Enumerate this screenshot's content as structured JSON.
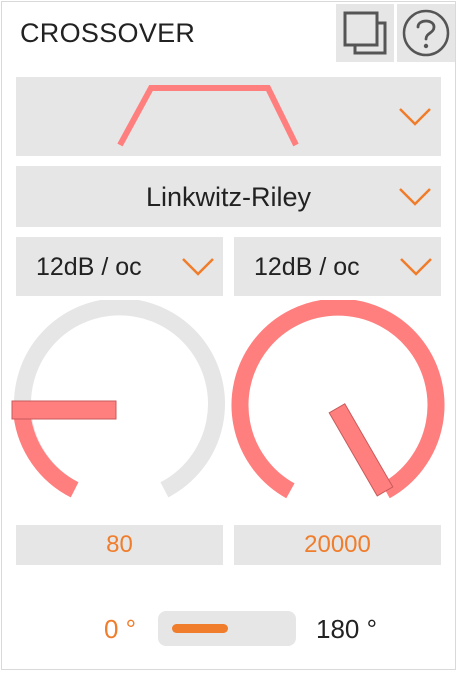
{
  "header": {
    "title": "CROSSOVER"
  },
  "icons": {
    "popout": "popout-icon",
    "help": "help-icon",
    "chevron": "chevron-down-icon"
  },
  "filter_shape": {
    "type": "band-pass"
  },
  "filter_type": {
    "selected": "Linkwitz-Riley"
  },
  "slopes": {
    "low": "12dB / oc",
    "high": "12dB / oc"
  },
  "knobs": {
    "low": {
      "value": "80",
      "level": 0.05
    },
    "high": {
      "value": "20000",
      "level": 1.0
    }
  },
  "phase": {
    "left_label": "0 °",
    "right_label": "180 °",
    "value": "0"
  },
  "colors": {
    "accent": "#f07d2b",
    "knob_fill": "#ff7f7f",
    "panel": "#e6e6e6"
  }
}
